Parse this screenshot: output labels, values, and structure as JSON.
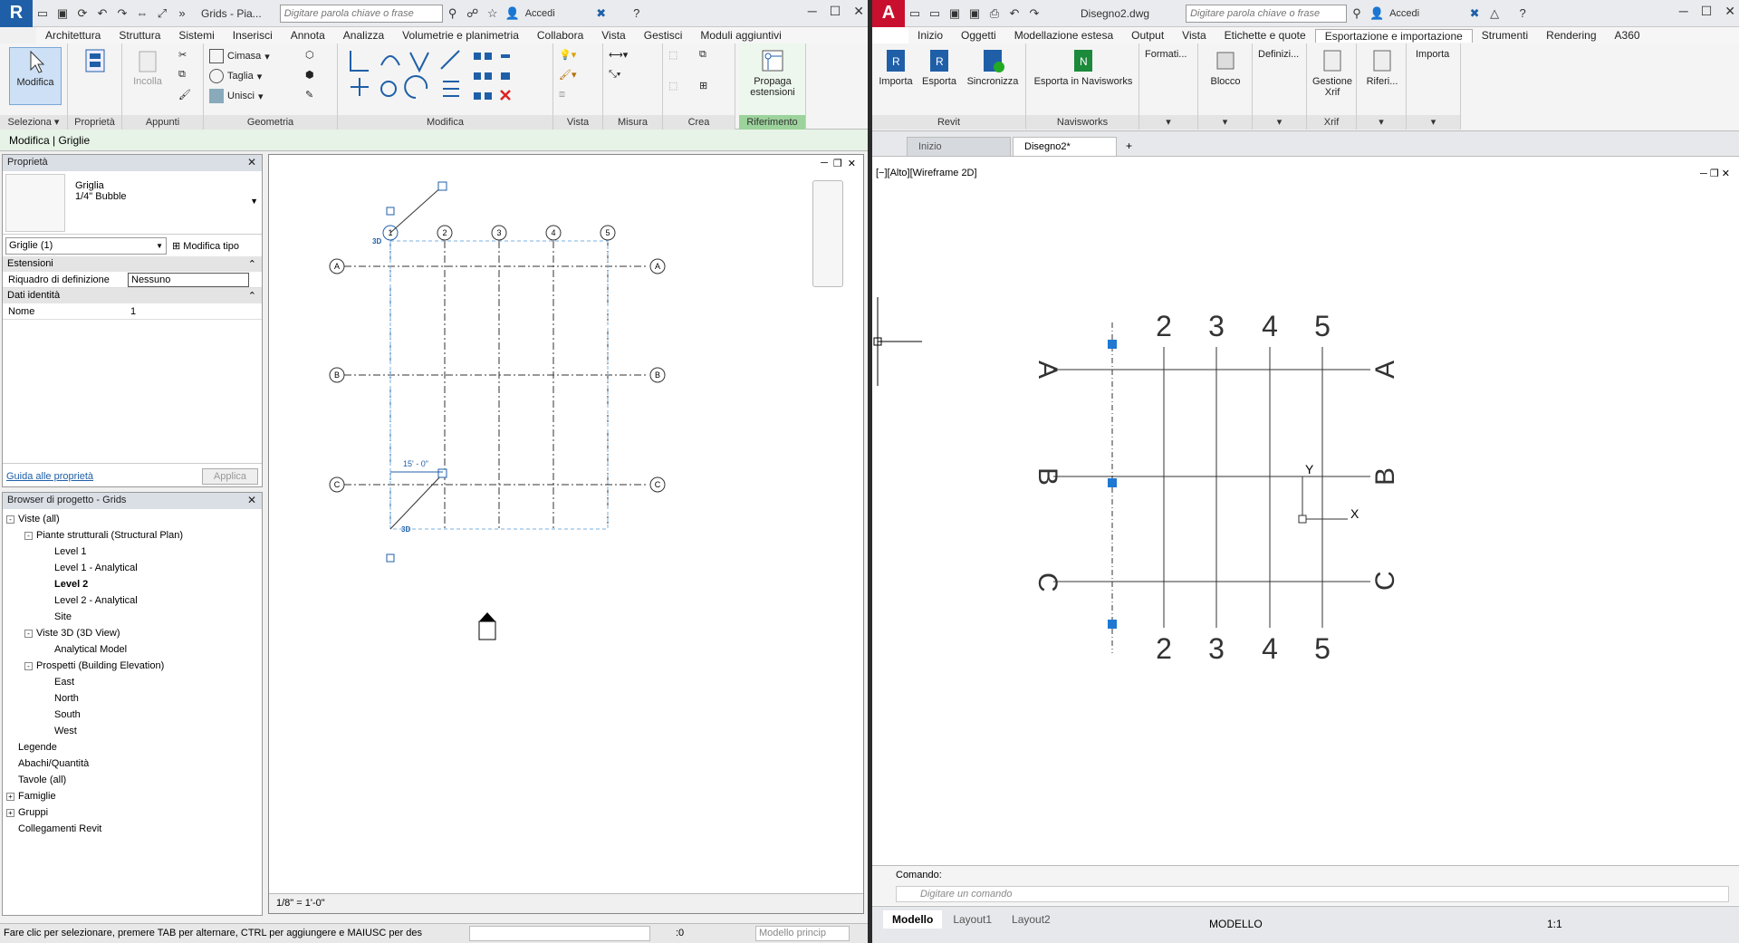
{
  "revit": {
    "title": "Grids - Pia...",
    "search_placeholder": "Digitare parola chiave o frase",
    "signin": "Accedi",
    "logo": "R",
    "tabs": [
      "Architettura",
      "Struttura",
      "Sistemi",
      "Inserisci",
      "Annota",
      "Analizza",
      "Volumetrie e planimetria",
      "Collabora",
      "Vista",
      "Gestisci",
      "Moduli aggiuntivi"
    ],
    "ribbon": {
      "modifica": "Modifica",
      "seleziona": "Seleziona",
      "proprieta": "Proprietà",
      "incolla": "Incolla",
      "appunti": "Appunti",
      "cimasa": "Cimasa",
      "taglia": "Taglia",
      "unisci": "Unisci",
      "geometria": "Geometria",
      "modifica_panel": "Modifica",
      "vista": "Vista",
      "misura": "Misura",
      "crea": "Crea",
      "propaga": "Propaga estensioni",
      "riferimento": "Riferimento"
    },
    "context": "Modifica | Griglie",
    "properties": {
      "header": "Proprietà",
      "type_name": "Griglia",
      "type_sub": "1/4\" Bubble",
      "selector": "Griglie (1)",
      "edit_type": "Modifica tipo",
      "sect_extent": "Estensioni",
      "scope_label": "Riquadro di definizione",
      "scope_value": "Nessuno",
      "sect_identity": "Dati identità",
      "name_label": "Nome",
      "name_value": "1",
      "help_link": "Guida alle proprietà",
      "apply": "Applica"
    },
    "browser": {
      "header": "Browser di progetto - Grids",
      "items": [
        {
          "label": "Viste (all)",
          "indent": 0,
          "exp": "-"
        },
        {
          "label": "Piante strutturali (Structural Plan)",
          "indent": 1,
          "exp": "-"
        },
        {
          "label": "Level 1",
          "indent": 2
        },
        {
          "label": "Level 1 - Analytical",
          "indent": 2
        },
        {
          "label": "Level 2",
          "indent": 2,
          "bold": true
        },
        {
          "label": "Level 2 - Analytical",
          "indent": 2
        },
        {
          "label": "Site",
          "indent": 2
        },
        {
          "label": "Viste 3D (3D View)",
          "indent": 1,
          "exp": "-"
        },
        {
          "label": "Analytical Model",
          "indent": 2
        },
        {
          "label": "Prospetti (Building Elevation)",
          "indent": 1,
          "exp": "-"
        },
        {
          "label": "East",
          "indent": 2
        },
        {
          "label": "North",
          "indent": 2
        },
        {
          "label": "South",
          "indent": 2
        },
        {
          "label": "West",
          "indent": 2
        },
        {
          "label": "Legende",
          "indent": 0
        },
        {
          "label": "Abachi/Quantità",
          "indent": 0
        },
        {
          "label": "Tavole (all)",
          "indent": 0
        },
        {
          "label": "Famiglie",
          "indent": 0,
          "exp": "+"
        },
        {
          "label": "Gruppi",
          "indent": 0,
          "exp": "+"
        },
        {
          "label": "Collegamenti Revit",
          "indent": 0
        }
      ]
    },
    "canvas": {
      "col_labels": [
        "1",
        "2",
        "3",
        "4",
        "5"
      ],
      "row_labels": [
        "A",
        "B",
        "C"
      ],
      "tag_3d": "3D",
      "dimension": "15' - 0\""
    },
    "scale": "1/8\" = 1'-0\"",
    "status": "Fare clic per selezionare, premere TAB per alternare, CTRL per aggiungere e MAIUSC per des",
    "status_zero": ":0",
    "status_model": "Modello princip"
  },
  "acad": {
    "logo": "A",
    "title": "Disegno2.dwg",
    "search_placeholder": "Digitare parola chiave o frase",
    "signin": "Accedi",
    "tabs": [
      "Inizio",
      "Oggetti",
      "Modellazione estesa",
      "Output",
      "Vista",
      "Etichette e quote",
      "Esportazione e importazione",
      "Strumenti",
      "Rendering",
      "A360"
    ],
    "active_tab": "Esportazione e importazione",
    "ribbon": {
      "importa": "Importa",
      "esporta": "Esporta",
      "sincronizza": "Sincronizza",
      "revit": "Revit",
      "esporta_nav": "Esporta in Navisworks",
      "navisworks": "Navisworks",
      "formati": "Formati...",
      "blocco": "Blocco",
      "definizi": "Definizi...",
      "gestione_xrif": "Gestione Xrif",
      "xrif": "Xrif",
      "riferi": "Riferi...",
      "importa2": "Importa"
    },
    "doc_tabs": [
      "Inizio",
      "Disegno2*"
    ],
    "viewport_label": "[−][Alto][Wireframe 2D]",
    "col_labels": [
      "2",
      "3",
      "4",
      "5"
    ],
    "row_labels": [
      "A",
      "B",
      "C"
    ],
    "axis_y": "Y",
    "axis_x": "X",
    "command_label": "Comando:",
    "command_placeholder": "Digitare un comando",
    "layout_tabs": [
      "Modello",
      "Layout1",
      "Layout2"
    ],
    "model_status": "MODELLO",
    "scale": "1:1"
  }
}
